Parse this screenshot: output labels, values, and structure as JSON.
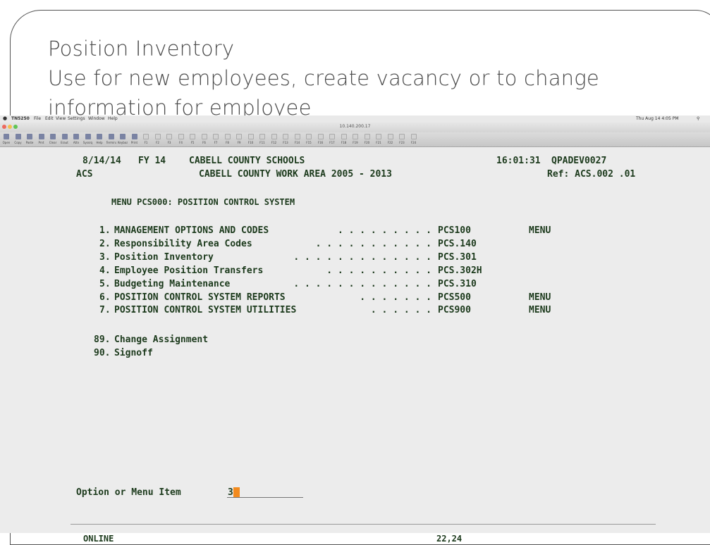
{
  "slide": {
    "title_line1": "Position Inventory",
    "title_line2": "Use for new employees, create vacancy or to change",
    "title_line3": "information for employee"
  },
  "menubar": {
    "app_name": "TN5250",
    "items": [
      "File",
      "Edit",
      "View",
      "Settings",
      "Window",
      "Help"
    ],
    "right_status": "Thu Aug 14 4:05 PM"
  },
  "window": {
    "title": "10.140.200.17"
  },
  "toolbar": {
    "buttons": [
      "Open",
      "Copy",
      "Paste",
      "Prnt",
      "Clear",
      "Eraut",
      "Attn",
      "Syssrq",
      "Help",
      "Terminal",
      "Keyboard",
      "Print",
      "F1",
      "F2",
      "F3",
      "F4",
      "F5",
      "F6",
      "F7",
      "F8",
      "F9",
      "F10",
      "F11",
      "F12",
      "F13",
      "F14",
      "F15",
      "F16",
      "F17",
      "F18",
      "F19",
      "F20",
      "F21",
      "F22",
      "F23",
      "F24"
    ]
  },
  "terminal": {
    "header": {
      "date": "8/14/14",
      "fy": "FY 14",
      "org": "CABELL COUNTY SCHOOLS",
      "time": "16:01:31",
      "device": "QPADEV0027",
      "system": "ACS",
      "area": "CABELL COUNTY WORK AREA 2005 - 2013",
      "ref": "Ref: ACS.002 .01"
    },
    "menu_title": "MENU PCS000: POSITION CONTROL SYSTEM",
    "menu_items": [
      {
        "num": "1.",
        "label": "MANAGEMENT OPTIONS AND CODES",
        "dots": ". . . . . . . . .",
        "code": "PCS100",
        "type": "MENU"
      },
      {
        "num": "2.",
        "label": "Responsibility Area Codes",
        "dots": ". . . . . . . . . . .",
        "code": "PCS.140",
        "type": ""
      },
      {
        "num": "3.",
        "label": "Position Inventory",
        "dots": ". . . . . . . . . . . . .",
        "code": "PCS.301",
        "type": ""
      },
      {
        "num": "4.",
        "label": "Employee Position Transfers",
        "dots": ". . . . . . . . . .",
        "code": "PCS.302H",
        "type": ""
      },
      {
        "num": "5.",
        "label": "Budgeting Maintenance",
        "dots": ". . . . . . . . . . . . .",
        "code": "PCS.310",
        "type": ""
      },
      {
        "num": "6.",
        "label": "POSITION CONTROL SYSTEM REPORTS",
        "dots": ". . . . . . .",
        "code": "PCS500",
        "type": "MENU"
      },
      {
        "num": "7.",
        "label": "POSITION CONTROL SYSTEM UTILITIES",
        "dots": ". . . . . .",
        "code": "PCS900",
        "type": "MENU"
      }
    ],
    "extra_items": [
      {
        "num": "89.",
        "label": "Change Assignment"
      },
      {
        "num": "90.",
        "label": "Signoff"
      }
    ],
    "prompt_label": "Option or Menu Item",
    "prompt_value": "3",
    "status": "ONLINE",
    "cursor_pos": "22,24"
  }
}
